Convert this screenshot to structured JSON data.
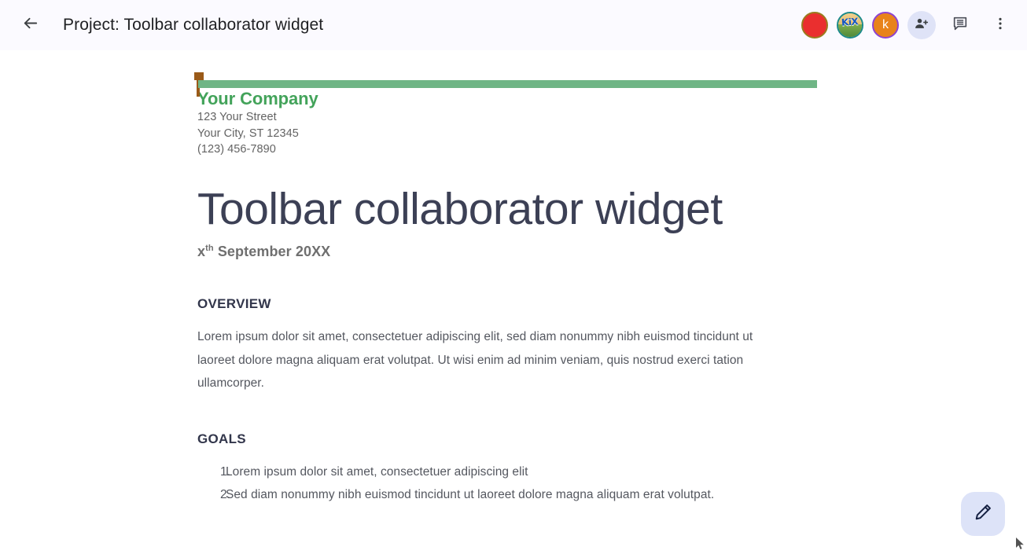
{
  "appbar": {
    "back_icon": "back-arrow-icon",
    "title": "Project: Toolbar collaborator widget",
    "collaborators": [
      {
        "name": "collaborator-red",
        "label": "",
        "type": "color-avatar",
        "color": "#ea2f2f",
        "ring": "#9a7b1e"
      },
      {
        "name": "collaborator-kix",
        "label": "KiX",
        "type": "image-avatar",
        "color": "#e8c98a",
        "ring": "#1b8a8a"
      },
      {
        "name": "collaborator-k",
        "label": "k",
        "type": "letter-avatar",
        "color": "#e8831a",
        "ring": "#8e44d0"
      }
    ],
    "add_person_icon": "person-add-icon",
    "comment_icon": "comment-icon",
    "overflow_icon": "more-vert-icon"
  },
  "document": {
    "letterhead": {
      "company": "Your Company",
      "address_line1": "123 Your Street",
      "address_line2": "Your City, ST 12345",
      "phone": "(123) 456-7890",
      "rule_color": "#6fb585",
      "caret_color": "#9a5a19"
    },
    "title": "Toolbar collaborator widget",
    "date_prefix": "x",
    "date_sup": "th",
    "date_rest": " September 20XX",
    "sections": [
      {
        "heading": "OVERVIEW",
        "body": "Lorem ipsum dolor sit amet, consectetuer adipiscing elit, sed diam nonummy nibh euismod tincidunt ut laoreet dolore magna aliquam erat volutpat. Ut wisi enim ad minim veniam, quis nostrud exerci tation ullamcorper."
      },
      {
        "heading": "GOALS",
        "items": [
          {
            "num": "1.",
            "text": "Lorem ipsum dolor sit amet, consectetuer adipiscing elit"
          },
          {
            "num": "2.",
            "text": "Sed diam nonummy nibh euismod tincidunt ut laoreet dolore magna aliquam erat volutpat."
          }
        ]
      }
    ]
  },
  "fab": {
    "icon": "pencil-icon",
    "color": "#dde3f8"
  }
}
